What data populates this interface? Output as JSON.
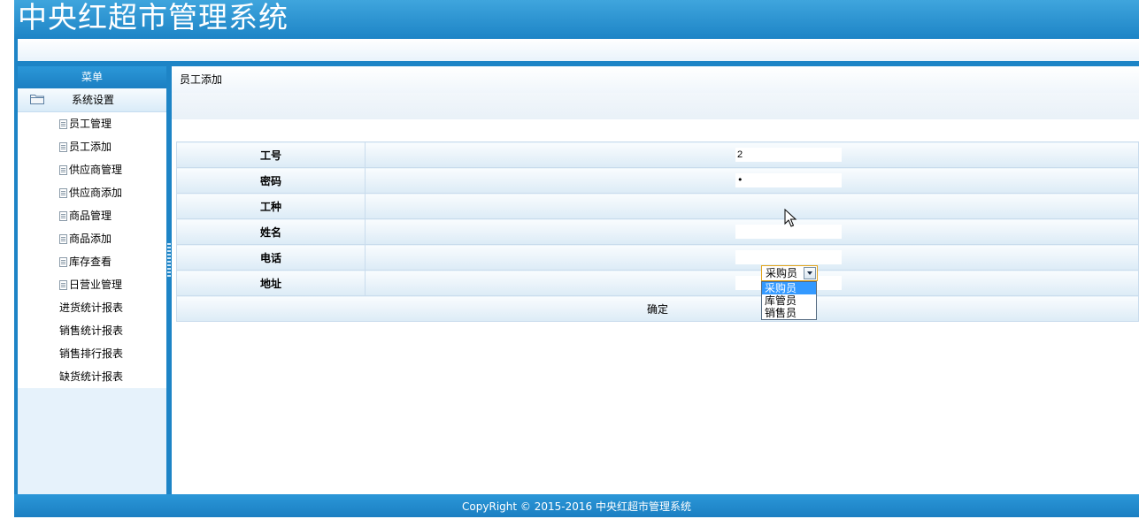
{
  "app": {
    "title": "中央红超市管理系统"
  },
  "sidebar": {
    "header": "菜单",
    "group": "系统设置",
    "items": [
      {
        "label": "员工管理"
      },
      {
        "label": "员工添加"
      },
      {
        "label": "供应商管理"
      },
      {
        "label": "供应商添加"
      },
      {
        "label": "商品管理"
      },
      {
        "label": "商品添加"
      },
      {
        "label": "库存查看"
      },
      {
        "label": "日营业管理"
      },
      {
        "label": "进货统计报表"
      },
      {
        "label": "销售统计报表"
      },
      {
        "label": "销售排行报表"
      },
      {
        "label": "缺货统计报表"
      }
    ]
  },
  "main": {
    "breadcrumb": "员工添加",
    "form": {
      "fields": [
        {
          "label": "工号",
          "value": "2"
        },
        {
          "label": "密码",
          "value": "•"
        },
        {
          "label": "工种",
          "value": ""
        },
        {
          "label": "姓名",
          "value": ""
        },
        {
          "label": "电话",
          "value": ""
        },
        {
          "label": "地址",
          "value": ""
        }
      ],
      "job_select": {
        "selected": "采购员",
        "options": [
          "采购员",
          "库管员",
          "销售员"
        ]
      },
      "submit_label": "确定"
    }
  },
  "footer": {
    "copyright": "CopyRight © 2015-2016 中央红超市管理系统"
  },
  "colors": {
    "primary": "#1d84c6",
    "highlight": "#3399ff"
  },
  "icons": {
    "group": "folder-icon",
    "item": "page-icon",
    "pointer": "cursor-icon"
  }
}
